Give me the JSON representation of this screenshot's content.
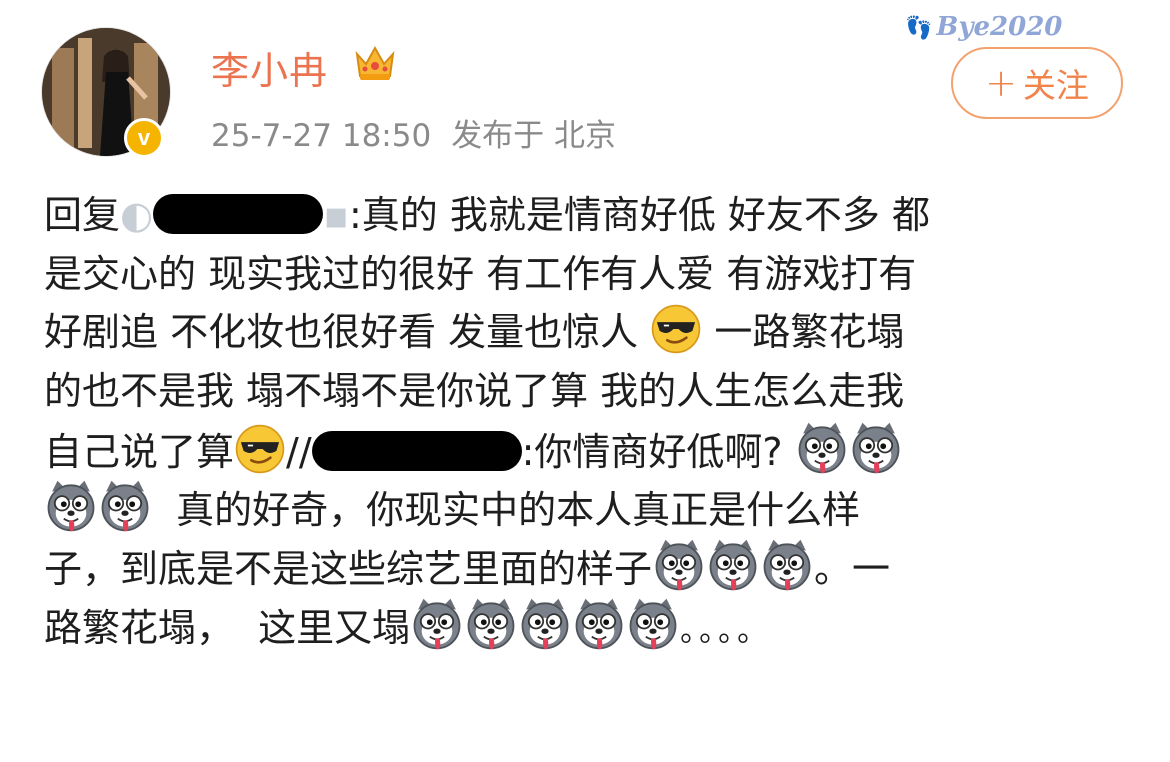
{
  "post": {
    "username": "李小冉",
    "timestamp": "25-7-27 18:50",
    "published_at": "发布于 北京",
    "follow_label": "关注",
    "follow_plus": "+",
    "verified_badge": "v",
    "watermark": "Bye2020"
  },
  "content": {
    "l1_prefix": "回复",
    "l1_text": ":真的 我就是情商好低 好友不多 都",
    "l2": "是交心的 现实我过的很好 有工作有人爱 有游戏打有",
    "l3_a": "好剧追 不化妆也很好看 发量也惊人",
    "l3_b": " 一路繁花塌",
    "l4": "的也不是我 塌不塌不是你说了算 我的人生怎么走我",
    "l5_a": "自己说了算",
    "l5_sep": "//",
    "l5_text": ":你情商好低啊?",
    "l6": "  真的好奇，你现实中的本人真正是什么样",
    "l7_a": "子，到底是不是这些综艺里面的样子",
    "l7_b": "。一",
    "l8_a": "路繁花塌，  这里又塌",
    "l8_dots": "。。。。"
  },
  "icons": {
    "avatar": "avatar-photo",
    "crown": "crown-icon",
    "sunglasses": "sunglasses-emoji",
    "husky": "husky-doge-emoji"
  },
  "colors": {
    "username": "#eb7350",
    "accent": "#f0844a",
    "badge": "#f5b400",
    "meta": "#8a8a8a"
  }
}
